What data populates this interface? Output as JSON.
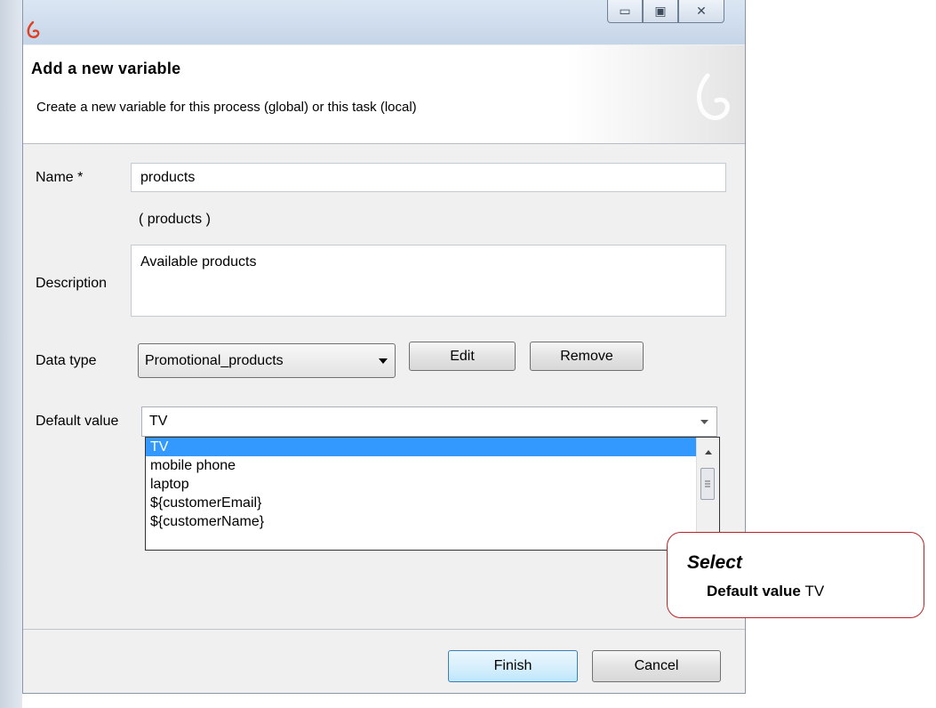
{
  "dialog": {
    "title": "Add a new variable",
    "subtitle": "Create a new variable for this process (global) or this task (local)"
  },
  "window_buttons": {
    "minimize": "▭",
    "maximize": "▣",
    "close": "✕"
  },
  "form": {
    "name_label": "Name *",
    "name_value": "products",
    "name_preview": "(  products  )",
    "description_label": "Description",
    "description_value": "Available products",
    "data_type_label": "Data type",
    "data_type_value": "Promotional_products",
    "edit_label": "Edit",
    "remove_label": "Remove",
    "default_label": "Default value",
    "default_value": "TV",
    "default_options": [
      "TV",
      "mobile phone",
      "laptop",
      "${customerEmail}",
      "${customerName}"
    ],
    "selected_option_index": 0
  },
  "footer": {
    "finish_label": "Finish",
    "cancel_label": "Cancel"
  },
  "callout": {
    "title": "Select",
    "field": "Default value",
    "value": "TV"
  },
  "colors": {
    "selection": "#3399ff",
    "callout_border": "#b52424"
  },
  "icons": {
    "app": "bonita-logo-icon",
    "dropdown": "chevron-down-icon",
    "scroll_up": "arrow-up-icon",
    "scroll_grip": "grip-icon"
  }
}
